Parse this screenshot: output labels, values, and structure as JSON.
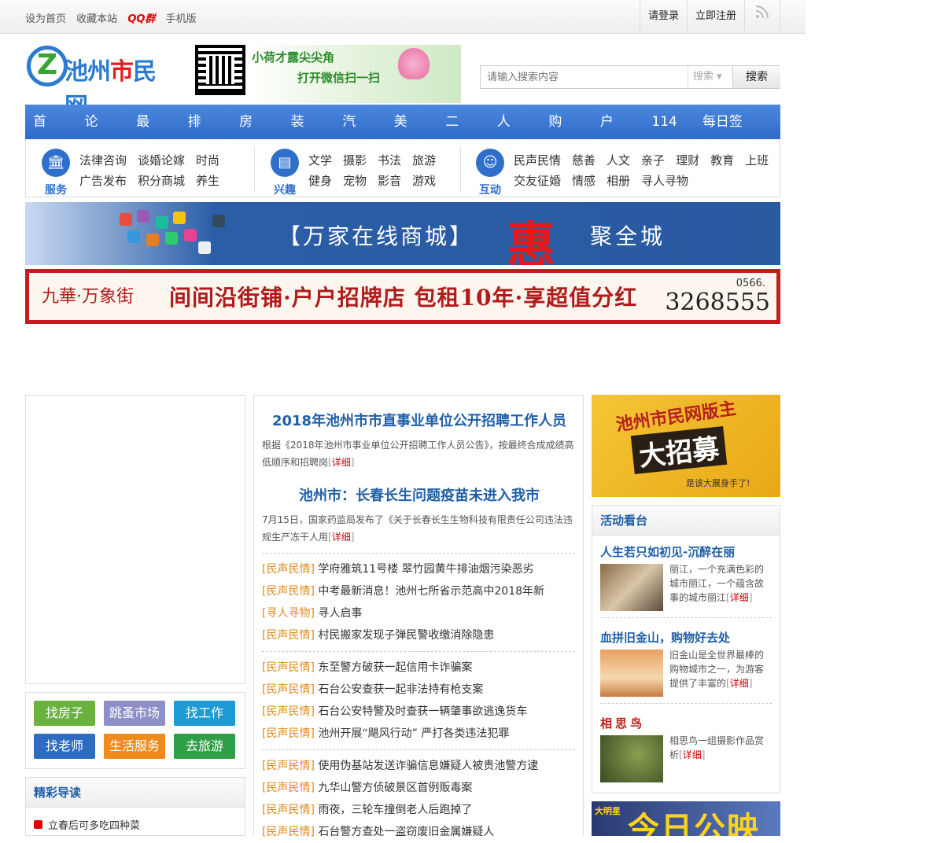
{
  "topbar": {
    "links": [
      "设为首页",
      "收藏本站",
      "QQ群",
      "手机版"
    ],
    "login": "请登录",
    "register": "立即注册"
  },
  "logo": {
    "text_blue": "池州",
    "text_red": "市",
    "text_blue2": "民网"
  },
  "wechat": {
    "line1": "小荷才露尖尖角",
    "line2": "打开微信扫一扫"
  },
  "search": {
    "placeholder": "请输入搜索内容",
    "type": "搜索",
    "button": "搜索"
  },
  "nav": [
    "首页",
    "论坛",
    "最新",
    "排行",
    "房产",
    "装修",
    "汽车",
    "美食",
    "二手",
    "人才",
    "购物",
    "户外",
    "114",
    "每日签到"
  ],
  "cats": [
    {
      "name": "服务",
      "row1": [
        "法律咨询",
        "谈婚论嫁",
        "时尚"
      ],
      "row2": [
        "广告发布",
        "积分商城",
        "养生"
      ]
    },
    {
      "name": "兴趣",
      "row1": [
        "文学",
        "摄影",
        "书法",
        "旅游"
      ],
      "row2": [
        "健身",
        "宠物",
        "影音",
        "游戏"
      ]
    },
    {
      "name": "互动",
      "row1": [
        "民声民情",
        "慈善",
        "人文",
        "亲子",
        "理财",
        "教育",
        "上班"
      ],
      "row2": [
        "交友征婚",
        "情感",
        "相册",
        "寻人寻物"
      ]
    }
  ],
  "banner1": {
    "text1": "【万家在线商城】",
    "hui": "惠",
    "text2": "聚全城"
  },
  "banner2": {
    "brand": "九華·万象街",
    "main": "间间沿街铺·户户招牌店 包租10年·享超值分红",
    "tel_prefix": "0566.",
    "tel": "3268555"
  },
  "quick": [
    "找房子",
    "跳蚤市场",
    "找工作",
    "找老师",
    "生活服务",
    "去旅游"
  ],
  "guide": {
    "title": "精彩导读",
    "item": "立春后可多吃四种菜"
  },
  "news": {
    "h1": "2018年池州市市直事业单位公开招聘工作人员",
    "p1": "根据《2018年池州市事业单位公开招聘工作人员公告》，按最终合成成绩高低顺序和招聘岗",
    "h2": "池州市：长春长生问题疫苗未进入我市",
    "p2": "7月15日，国家药监局发布了《关于长春长生生物科技有限责任公司违法违规生产冻干人用",
    "detail": "详细",
    "group1": [
      {
        "tag": "民声民情",
        "title": "学府雅筑11号楼 翠竹园黄牛排油烟污染恶劣"
      },
      {
        "tag": "民声民情",
        "title": "中考最新消息！池州七所省示范高中2018年新"
      },
      {
        "tag": "寻人寻物",
        "title": "寻人启事"
      },
      {
        "tag": "民声民情",
        "title": "村民搬家发现子弹民警收缴消除隐患"
      }
    ],
    "group2": [
      {
        "tag": "民声民情",
        "title": "东至警方破获一起信用卡诈骗案"
      },
      {
        "tag": "民声民情",
        "title": "石台公安查获一起非法持有枪支案"
      },
      {
        "tag": "民声民情",
        "title": "石台公安特警及时查获一辆肇事欲逃逸货车"
      },
      {
        "tag": "民声民情",
        "title": "池州开展“飓风行动” 严打各类违法犯罪"
      }
    ],
    "group3": [
      {
        "tag": "民声民情",
        "title": "使用伪基站发送诈骗信息嫌疑人被贵池警方逮"
      },
      {
        "tag": "民声民情",
        "title": "九华山警方侦破景区首例贩毒案"
      },
      {
        "tag": "民声民情",
        "title": "雨夜，三轮车撞倒老人后跑掉了"
      },
      {
        "tag": "民声民情",
        "title": "石台警方查处一盗窃废旧金属嫌疑人"
      }
    ]
  },
  "recruit": {
    "line1": "池州市民网版主",
    "line2": "大招募",
    "line3": "是该大展身手了!"
  },
  "activity": {
    "title": "活动看台",
    "items": [
      {
        "title": "人生若只如初见-沉醉在丽",
        "desc": "丽江，一个充满色彩的城市丽江，一个蕴含故事的城市丽江"
      },
      {
        "title": "血拼旧金山，购物好去处",
        "desc": "旧金山是全世界最棒的购物城市之一，为游客提供了丰富的"
      },
      {
        "title": "相思鸟",
        "desc": "相思鸟一组摄影作品赏析"
      }
    ]
  },
  "movie": {
    "logo": "大明星",
    "text": "今日公映"
  }
}
